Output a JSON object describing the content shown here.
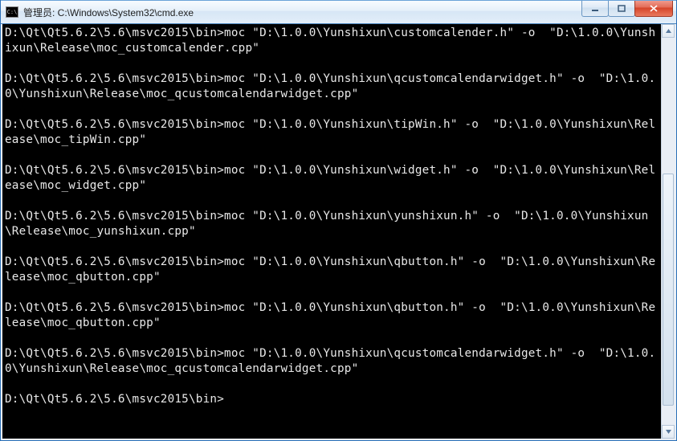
{
  "window": {
    "title": "管理员: C:\\Windows\\System32\\cmd.exe"
  },
  "console": {
    "prompt": "D:\\Qt\\Qt5.6.2\\5.6\\msvc2015\\bin>",
    "lines": [
      "D:\\Qt\\Qt5.6.2\\5.6\\msvc2015\\bin>moc \"D:\\1.0.0\\Yunshixun\\customcalender.h\" -o  \"D:\\1.0.0\\Yunshixun\\Release\\moc_customcalender.cpp\"",
      "",
      "D:\\Qt\\Qt5.6.2\\5.6\\msvc2015\\bin>moc \"D:\\1.0.0\\Yunshixun\\qcustomcalendarwidget.h\" -o  \"D:\\1.0.0\\Yunshixun\\Release\\moc_qcustomcalendarwidget.cpp\"",
      "",
      "D:\\Qt\\Qt5.6.2\\5.6\\msvc2015\\bin>moc \"D:\\1.0.0\\Yunshixun\\tipWin.h\" -o  \"D:\\1.0.0\\Yunshixun\\Release\\moc_tipWin.cpp\"",
      "",
      "D:\\Qt\\Qt5.6.2\\5.6\\msvc2015\\bin>moc \"D:\\1.0.0\\Yunshixun\\widget.h\" -o  \"D:\\1.0.0\\Yunshixun\\Release\\moc_widget.cpp\"",
      "",
      "D:\\Qt\\Qt5.6.2\\5.6\\msvc2015\\bin>moc \"D:\\1.0.0\\Yunshixun\\yunshixun.h\" -o  \"D:\\1.0.0\\Yunshixun\\Release\\moc_yunshixun.cpp\"",
      "",
      "D:\\Qt\\Qt5.6.2\\5.6\\msvc2015\\bin>moc \"D:\\1.0.0\\Yunshixun\\qbutton.h\" -o  \"D:\\1.0.0\\Yunshixun\\Release\\moc_qbutton.cpp\"",
      "",
      "D:\\Qt\\Qt5.6.2\\5.6\\msvc2015\\bin>moc \"D:\\1.0.0\\Yunshixun\\qbutton.h\" -o  \"D:\\1.0.0\\Yunshixun\\Release\\moc_qbutton.cpp\"",
      "",
      "D:\\Qt\\Qt5.6.2\\5.6\\msvc2015\\bin>moc \"D:\\1.0.0\\Yunshixun\\qcustomcalendarwidget.h\" -o  \"D:\\1.0.0\\Yunshixun\\Release\\moc_qcustomcalendarwidget.cpp\"",
      ""
    ]
  }
}
